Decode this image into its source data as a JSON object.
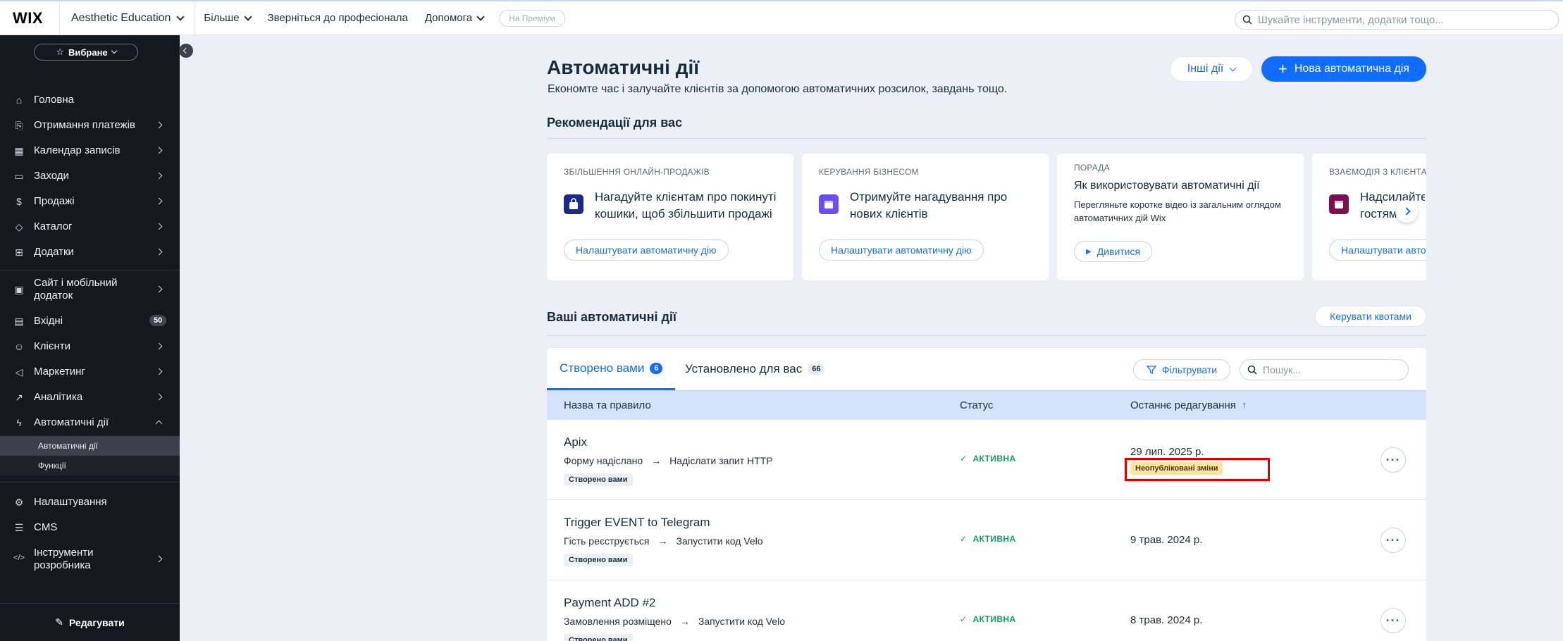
{
  "topbar": {
    "logo": "WIX",
    "site_name": "Aesthetic Education",
    "nav": [
      "Більше",
      "Зверніться до професіонала",
      "Допомога"
    ],
    "premium": "На Преміум",
    "search_placeholder": "Шукайте інструменти, додатки тощо..."
  },
  "sidebar": {
    "favorites": "Вибране",
    "items": [
      {
        "label": "Головна",
        "icon": "home-icon"
      },
      {
        "label": "Отримання платежів",
        "icon": "payments-icon"
      },
      {
        "label": "Календар записів",
        "icon": "calendar-icon"
      },
      {
        "label": "Заходи",
        "icon": "events-icon"
      },
      {
        "label": "Продажі",
        "icon": "sales-icon"
      },
      {
        "label": "Каталог",
        "icon": "catalog-icon"
      },
      {
        "label": "Додатки",
        "icon": "apps-icon"
      },
      {
        "label": "Сайт і мобільний додаток",
        "icon": "site-mobile-icon"
      },
      {
        "label": "Вхідні",
        "icon": "inbox-icon",
        "badge": "50"
      },
      {
        "label": "Клієнти",
        "icon": "clients-icon"
      },
      {
        "label": "Маркетинг",
        "icon": "marketing-icon"
      },
      {
        "label": "Аналітика",
        "icon": "analytics-icon"
      },
      {
        "label": "Автоматичні дії",
        "icon": "automations-icon"
      },
      {
        "label": "Налаштування",
        "icon": "settings-icon"
      },
      {
        "label": "CMS",
        "icon": "cms-icon"
      },
      {
        "label": "Інструменти розробника",
        "icon": "dev-tools-icon"
      }
    ],
    "subitems": [
      "Автоматичні дії",
      "Функції"
    ],
    "edit": "Редагувати"
  },
  "page": {
    "title": "Автоматичні дії",
    "subtitle": "Економте час і залучайте клієнтів за допомогою автоматичних розсилок, завдань тощо.",
    "other_actions": "Інші дії",
    "new_automation": "Нова автоматична дія",
    "recommendations_title": "Рекомендації для вас",
    "your_automations_title": "Ваші автоматичні дії",
    "manage_quotas": "Керувати квотами"
  },
  "recommendations": [
    {
      "kicker": "ЗБІЛЬШЕННЯ ОНЛАЙН-ПРОДАЖІВ",
      "text": "Нагадуйте клієнтам про покинуті кошики, щоб збільшити продажі",
      "link": "Налаштувати автоматичну дію",
      "icon_color": "#1a2a8a"
    },
    {
      "kicker": "КЕРУВАННЯ БІЗНЕСОМ",
      "text": "Отримуйте нагадування про нових клієнтів",
      "link": "Налаштувати автоматичну дію",
      "icon_color": "#6b4ef0"
    },
    {
      "kicker": "ПОРАДА",
      "title": "Як використовувати автоматичні дії",
      "text": "Перегляньте коротке відео із загальним оглядом автоматичних дій Wix",
      "link": "Дивитися"
    },
    {
      "kicker": "ВЗАЄМОДІЯ З КЛІЄНТА",
      "text": "Надсилайте гостям",
      "link": "Налаштувати авто",
      "icon_color": "#7a1050"
    }
  ],
  "tabs": [
    {
      "label": "Створено вами",
      "count": "6"
    },
    {
      "label": "Установлено для вас",
      "count": "66"
    }
  ],
  "filter_label": "Фільтрувати",
  "table_search_placeholder": "Пошук...",
  "columns": [
    "Назва та правило",
    "Статус",
    "Останнє редагування"
  ],
  "rows": [
    {
      "name": "Apix",
      "trigger": "Форму надіслано",
      "action": "Надіслати запит HTTP",
      "tag": "Створено вами",
      "status": "АКТИВНА",
      "date": "29 лип. 2025 р.",
      "unpublished": "Неопубліковані зміни"
    },
    {
      "name": "Trigger EVENT to Telegram",
      "trigger": "Гість реєструється",
      "action": "Запустити код Velo",
      "tag": "Створено вами",
      "status": "АКТИВНА",
      "date": "9 трав. 2024 р."
    },
    {
      "name": "Payment ADD #2",
      "trigger": "Замовлення розміщено",
      "action": "Запустити код Velo",
      "tag": "Створено вами",
      "status": "АКТИВНА",
      "date": "8 трав. 2024 р."
    }
  ],
  "colors": {
    "accent": "#116dff",
    "active_status": "#12a05e",
    "sidebar_bg": "#14181f",
    "highlight": "#e00000"
  }
}
